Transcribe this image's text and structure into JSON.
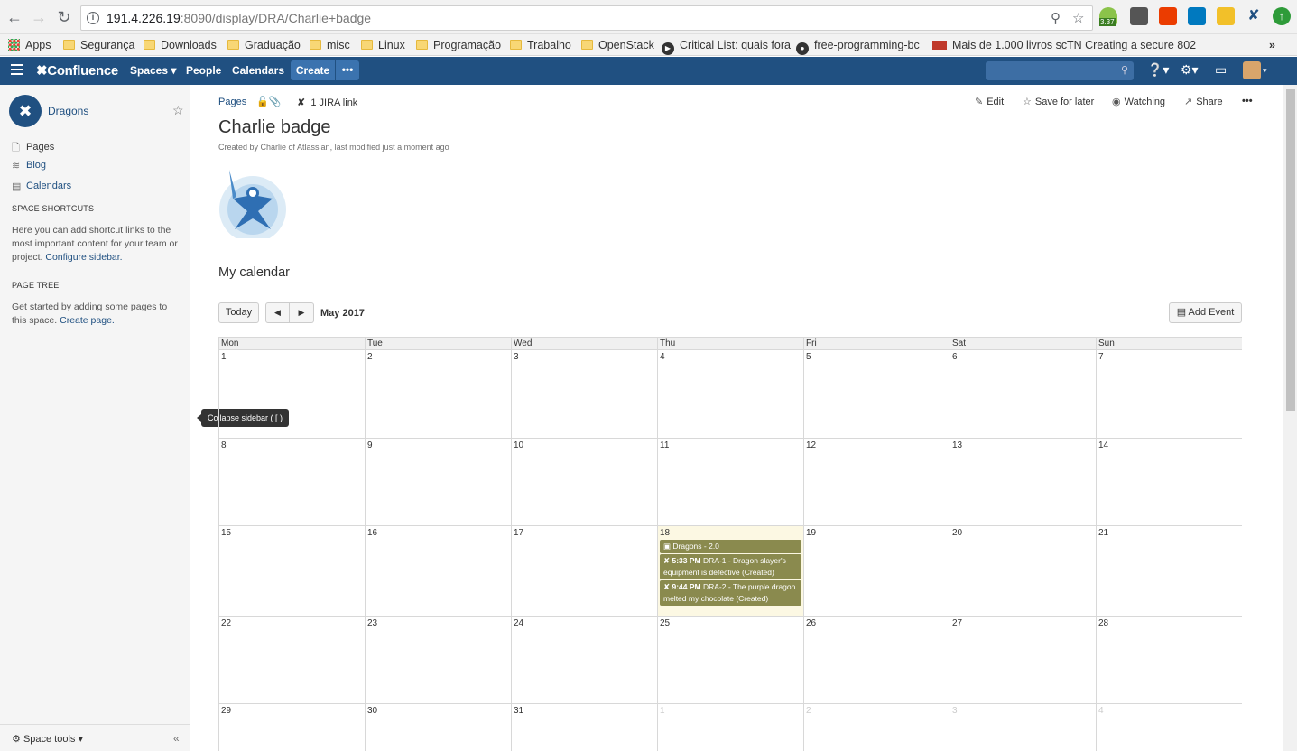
{
  "browser": {
    "url_host": "191.4.226.19",
    "url_rest": ":8090/display/DRA/Charlie+badge",
    "extension_badge": "3.37",
    "bookmarks": [
      {
        "label": "Apps",
        "icon": "apps-grid-icon"
      },
      {
        "label": "Segurança",
        "icon": "folder-icon"
      },
      {
        "label": "Downloads",
        "icon": "folder-icon"
      },
      {
        "label": "Graduação",
        "icon": "folder-icon"
      },
      {
        "label": "misc",
        "icon": "folder-icon"
      },
      {
        "label": "Linux",
        "icon": "folder-icon"
      },
      {
        "label": "Programação",
        "icon": "folder-icon"
      },
      {
        "label": "Trabalho",
        "icon": "folder-icon"
      },
      {
        "label": "OpenStack",
        "icon": "folder-icon"
      },
      {
        "label": "Critical List: quais fora",
        "icon": "play-icon"
      },
      {
        "label": "free-programming-bc",
        "icon": "github-icon"
      },
      {
        "label": "Mais de 1.000 livros sc",
        "icon": "site-icon"
      },
      {
        "label": "TN  Creating a secure 802",
        "icon": "none"
      }
    ],
    "more_bookmarks": "»"
  },
  "header": {
    "logo": "Confluence",
    "spaces": "Spaces",
    "people": "People",
    "calendars": "Calendars",
    "create": "Create",
    "more": "•••"
  },
  "sidebar": {
    "space_name": "Dragons",
    "links": [
      "Pages",
      "Blog",
      "Calendars"
    ],
    "shortcuts_heading": "SPACE SHORTCUTS",
    "shortcuts_text": "Here you can add shortcut links to the most important content for your team or project.",
    "shortcuts_link": "Configure sidebar.",
    "tree_heading": "PAGE TREE",
    "tree_text": "Get started by adding some pages to this space.",
    "tree_link": "Create page.",
    "space_tools": "Space tools",
    "tooltip": "Collapse sidebar ( [ )"
  },
  "page": {
    "breadcrumb": "Pages",
    "jira_link": "1 JIRA link",
    "actions": {
      "edit": "Edit",
      "save_for_later": "Save for later",
      "watching": "Watching",
      "share": "Share",
      "more": "•••"
    },
    "title": "Charlie badge",
    "byline": "Created by Charlie of Atlassian, last modified just a moment ago",
    "calendar_heading": "My calendar"
  },
  "calendar": {
    "today_label": "Today",
    "prev_label": "◀",
    "next_label": "▶",
    "month": "May 2017",
    "add_event": "Add Event",
    "weekdays": [
      "Mon",
      "Tue",
      "Wed",
      "Thu",
      "Fri",
      "Sat",
      "Sun"
    ],
    "weeks": [
      [
        "1",
        "2",
        "3",
        "4",
        "5",
        "6",
        "7"
      ],
      [
        "8",
        "9",
        "10",
        "11",
        "12",
        "13",
        "14"
      ],
      [
        "15",
        "16",
        "17",
        "18",
        "19",
        "20",
        "21"
      ],
      [
        "22",
        "23",
        "24",
        "25",
        "26",
        "27",
        "28"
      ],
      [
        "29",
        "30",
        "31",
        "1",
        "2",
        "3",
        "4"
      ]
    ],
    "events_day": "18",
    "events": [
      {
        "time": "",
        "text": "Dragons - 2.0",
        "icon": "gift-icon"
      },
      {
        "time": "5:33 PM",
        "text": "DRA-1 - Dragon slayer's equipment is defective (Created)",
        "icon": "jira-icon"
      },
      {
        "time": "9:44 PM",
        "text": "DRA-2 - The purple dragon melted my chocolate (Created)",
        "icon": "jira-icon"
      }
    ],
    "event_color": "#8a8a4e",
    "today_highlight": "#fcf8e3"
  },
  "colors": {
    "brand": "#205081",
    "button": "#3b73af"
  }
}
